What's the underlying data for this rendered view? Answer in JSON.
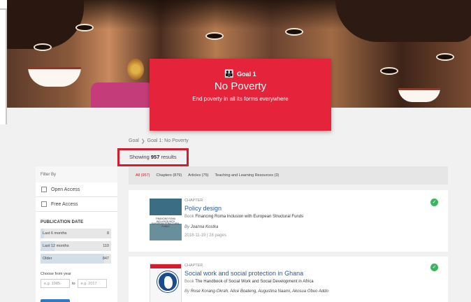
{
  "goal": {
    "number_label": "Goal 1",
    "title": "No Poverty",
    "subtitle": "End poverty in all its forms everywhere",
    "icon": "family-icon"
  },
  "breadcrumb": {
    "root": "Goal",
    "current": "Goal 1: No Poverty"
  },
  "showing": {
    "prefix": "Showing",
    "count": "957",
    "suffix": "results"
  },
  "sidebar": {
    "filter_by": "Filter By",
    "checks": [
      {
        "label": "Open Access"
      },
      {
        "label": "Free Access"
      }
    ],
    "pub_date_title": "PUBLICATION DATE",
    "date_bars": [
      {
        "label": "Last 6 months",
        "count": "8",
        "fraction": 0.05
      },
      {
        "label": "Last 12 months",
        "count": "110",
        "fraction": 0.2
      },
      {
        "label": "Older",
        "count": "847",
        "fraction": 0.9
      }
    ],
    "year_label": "Choose from year",
    "year_from_placeholder": "e.g. 1985",
    "year_to": "to",
    "year_to_placeholder": "e.g. 2017"
  },
  "tabs": [
    {
      "label": "All (957)"
    },
    {
      "label": "Chapters (879)"
    },
    {
      "label": "Articles (75)"
    },
    {
      "label": "Teaching and Learning Resources (3)"
    }
  ],
  "results": [
    {
      "type": "CHAPTER",
      "title": "Policy design",
      "book_label": "Book",
      "book": "Financing Roma Inclusion with European Structural Funds",
      "by": "By",
      "authors": "Joanna Kostka",
      "meta": "2018-11-19 | 28 pages",
      "cover_text": "FINANCING ROMA INCLUSION WITH EUROPEAN STRUCTURAL FUNDS"
    },
    {
      "type": "CHAPTER",
      "title": "Social work and social protection in Ghana",
      "book_label": "Book",
      "book": "The Handbook of Social Work and Social Development in Africa",
      "by": "By",
      "authors": "Rose Korang-Okrah, Alice Boateng, Augustina Naami, Akosua Obuo Addo"
    }
  ],
  "colors": {
    "goal_red": "#e5243b",
    "highlight": "#d11d2f",
    "link": "#2a5b9c",
    "badge": "#3bb45e"
  }
}
